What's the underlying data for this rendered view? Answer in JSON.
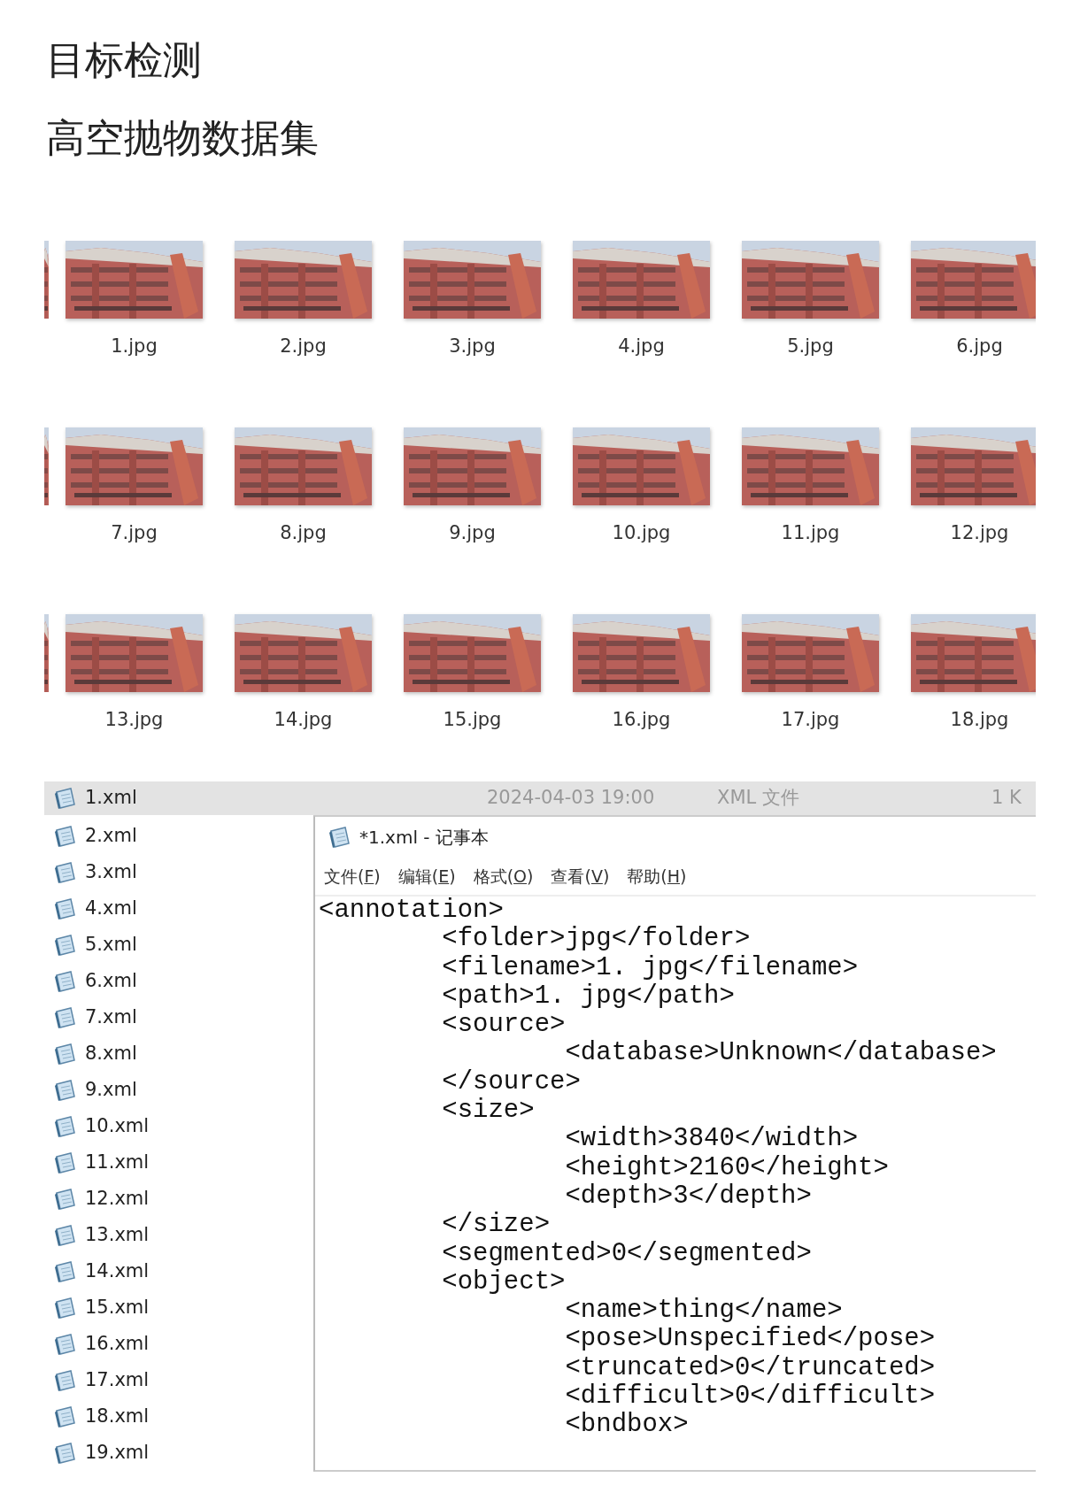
{
  "title": "目标检测",
  "subtitle": "高空抛物数据集",
  "images": [
    {
      "label": "1.jpg"
    },
    {
      "label": "2.jpg"
    },
    {
      "label": "3.jpg"
    },
    {
      "label": "4.jpg"
    },
    {
      "label": "5.jpg"
    },
    {
      "label": "6.jpg"
    },
    {
      "label": "7.jpg"
    },
    {
      "label": "8.jpg"
    },
    {
      "label": "9.jpg"
    },
    {
      "label": "10.jpg"
    },
    {
      "label": "11.jpg"
    },
    {
      "label": "12.jpg"
    },
    {
      "label": "13.jpg"
    },
    {
      "label": "14.jpg"
    },
    {
      "label": "15.jpg"
    },
    {
      "label": "16.jpg"
    },
    {
      "label": "17.jpg"
    },
    {
      "label": "18.jpg"
    }
  ],
  "xml_files": [
    {
      "name": "1.xml",
      "selected": true,
      "date": "2024-04-03 19:00",
      "type": "XML 文件",
      "size": "1 K"
    },
    {
      "name": "2.xml",
      "selected": false
    },
    {
      "name": "3.xml",
      "selected": false
    },
    {
      "name": "4.xml",
      "selected": false
    },
    {
      "name": "5.xml",
      "selected": false
    },
    {
      "name": "6.xml",
      "selected": false
    },
    {
      "name": "7.xml",
      "selected": false
    },
    {
      "name": "8.xml",
      "selected": false
    },
    {
      "name": "9.xml",
      "selected": false
    },
    {
      "name": "10.xml",
      "selected": false
    },
    {
      "name": "11.xml",
      "selected": false
    },
    {
      "name": "12.xml",
      "selected": false
    },
    {
      "name": "13.xml",
      "selected": false
    },
    {
      "name": "14.xml",
      "selected": false
    },
    {
      "name": "15.xml",
      "selected": false
    },
    {
      "name": "16.xml",
      "selected": false
    },
    {
      "name": "17.xml",
      "selected": false
    },
    {
      "name": "18.xml",
      "selected": false
    },
    {
      "name": "19.xml",
      "selected": false
    }
  ],
  "notepad": {
    "title": "*1.xml - 记事本",
    "menu": [
      "文件(F)",
      "编辑(E)",
      "格式(O)",
      "查看(V)",
      "帮助(H)"
    ],
    "lines": [
      "<annotation>",
      "\t<folder>jpg</folder>",
      "\t<filename>1. jpg</filename>",
      "\t<path>1. jpg</path>",
      "\t<source>",
      "\t\t<database>Unknown</database>",
      "\t</source>",
      "\t<size>",
      "\t\t<width>3840</width>",
      "\t\t<height>2160</height>",
      "\t\t<depth>3</depth>",
      "\t</size>",
      "\t<segmented>0</segmented>",
      "\t<object>",
      "\t\t<name>thing</name>",
      "\t\t<pose>Unspecified</pose>",
      "\t\t<truncated>0</truncated>",
      "\t\t<difficult>0</difficult>",
      "\t\t<bndbox>"
    ]
  }
}
